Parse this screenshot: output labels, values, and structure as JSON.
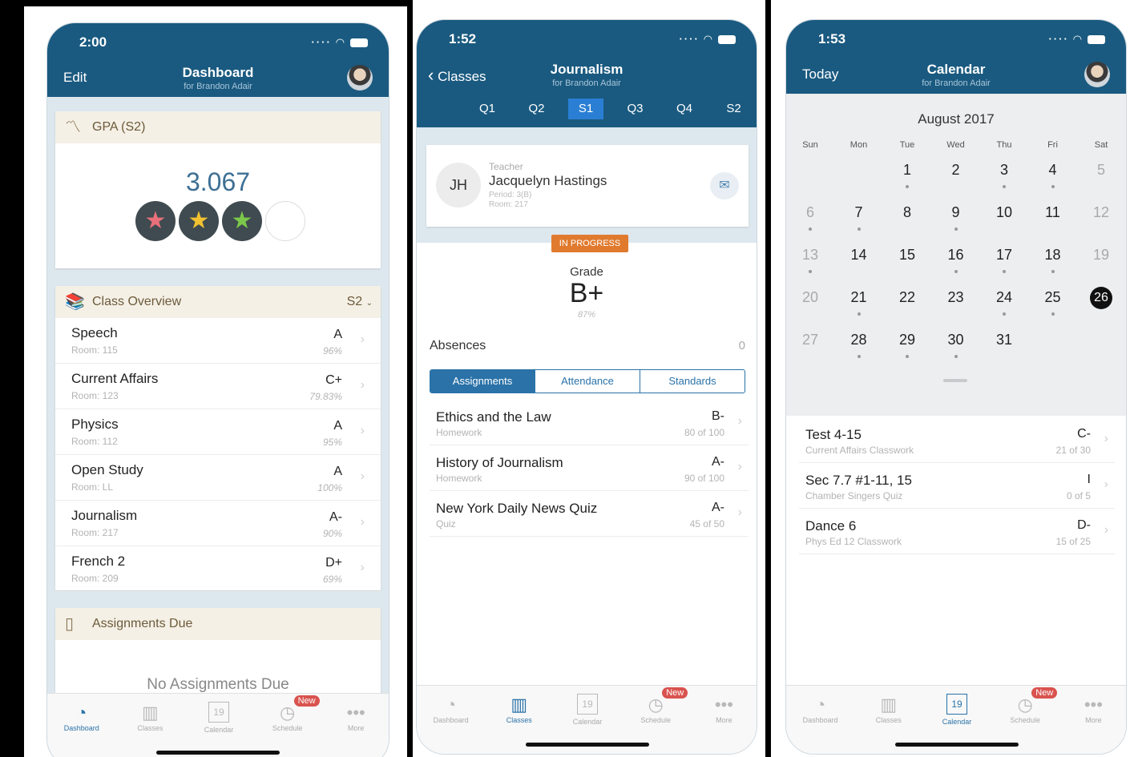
{
  "screens": {
    "dashboard": {
      "time": "2:00",
      "nav_left": "Edit",
      "title": "Dashboard",
      "subtitle": "for Brandon Adair",
      "gpa": {
        "header": "GPA (S2)",
        "value": "3.067",
        "stars": 3,
        "max_stars": 4,
        "star_colors": [
          "#e8707a",
          "#f2c230",
          "#7cc84a"
        ]
      },
      "class_overview": {
        "header": "Class Overview",
        "term": "S2",
        "classes": [
          {
            "name": "Speech",
            "room": "Room: 115",
            "grade": "A",
            "percent": "96%"
          },
          {
            "name": "Current Affairs",
            "room": "Room: 123",
            "grade": "C+",
            "percent": "79.83%"
          },
          {
            "name": "Physics",
            "room": "Room: 112",
            "grade": "A",
            "percent": "95%"
          },
          {
            "name": "Open Study",
            "room": "Room: LL",
            "grade": "A",
            "percent": "100%"
          },
          {
            "name": "Journalism",
            "room": "Room: 217",
            "grade": "A-",
            "percent": "90%"
          },
          {
            "name": "French 2",
            "room": "Room: 209",
            "grade": "D+",
            "percent": "69%"
          }
        ]
      },
      "assignments_due": {
        "header": "Assignments Due",
        "empty": "No Assignments Due"
      }
    },
    "journalism": {
      "time": "1:52",
      "back_label": "Classes",
      "title": "Journalism",
      "subtitle": "for Brandon Adair",
      "quarters": [
        "Q1",
        "Q2",
        "S1",
        "Q3",
        "Q4",
        "S2"
      ],
      "selected_quarter": "S1",
      "teacher": {
        "label": "Teacher",
        "initials": "JH",
        "name": "Jacquelyn Hastings",
        "period": "Period: 3(B)",
        "room": "Room: 217"
      },
      "status": "IN PROGRESS",
      "grade_label": "Grade",
      "grade": "B+",
      "grade_percent": "87%",
      "absences_label": "Absences",
      "absences": "0",
      "segments": [
        "Assignments",
        "Attendance",
        "Standards"
      ],
      "assignments": [
        {
          "name": "Ethics and the Law",
          "type": "Homework",
          "grade": "B-",
          "score": "80 of 100"
        },
        {
          "name": "History of Journalism",
          "type": "Homework",
          "grade": "A-",
          "score": "90 of 100"
        },
        {
          "name": "New York Daily News Quiz",
          "type": "Quiz",
          "grade": "A-",
          "score": "45 of 50"
        }
      ]
    },
    "calendar": {
      "time": "1:53",
      "nav_left": "Today",
      "title": "Calendar",
      "subtitle": "for Brandon Adair",
      "month": "August 2017",
      "weekdays": [
        "Sun",
        "Mon",
        "Tue",
        "Wed",
        "Thu",
        "Fri",
        "Sat"
      ],
      "today": "26",
      "events": [
        {
          "name": "Test 4-15",
          "course": "Current Affairs Classwork",
          "grade": "C-",
          "score": "21 of 30"
        },
        {
          "name": "Sec 7.7 #1-11, 15",
          "course": "Chamber Singers Quiz",
          "grade": "I",
          "score": "0 of 5"
        },
        {
          "name": "Dance 6",
          "course": "Phys Ed 12 Classwork",
          "grade": "D-",
          "score": "15 of 25"
        }
      ]
    }
  },
  "tabbar": {
    "items": [
      {
        "label": "Dashboard",
        "icon": "gauge-icon"
      },
      {
        "label": "Classes",
        "icon": "books-icon"
      },
      {
        "label": "Calendar",
        "icon": "calendar-icon"
      },
      {
        "label": "Schedule",
        "icon": "clock-icon"
      },
      {
        "label": "More",
        "icon": "more-icon"
      }
    ],
    "calendar_day": "19",
    "new_badge": "New"
  },
  "colors": {
    "nav": "#1a5a80",
    "accent": "#2a72a8",
    "status_badge": "#e07a2e",
    "new_badge": "#d9534f"
  }
}
